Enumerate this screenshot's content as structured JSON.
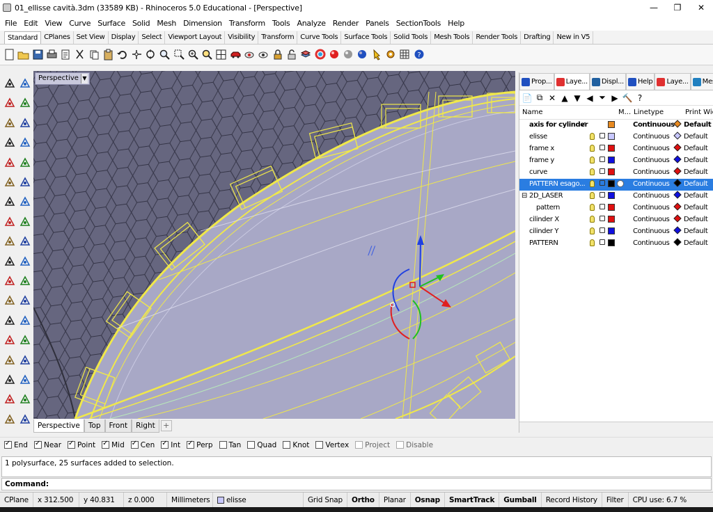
{
  "title": "01_ellisse cavità.3dm (33589 KB) - Rhinoceros 5.0 Educational - [Perspective]",
  "window_controls": {
    "minimize": "—",
    "maximize": "❐",
    "close": "✕"
  },
  "menu": [
    "File",
    "Edit",
    "View",
    "Curve",
    "Surface",
    "Solid",
    "Mesh",
    "Dimension",
    "Transform",
    "Tools",
    "Analyze",
    "Render",
    "Panels",
    "SectionTools",
    "Help"
  ],
  "toolbar_tabs": [
    "Standard",
    "CPlanes",
    "Set View",
    "Display",
    "Select",
    "Viewport Layout",
    "Visibility",
    "Transform",
    "Curve Tools",
    "Surface Tools",
    "Solid Tools",
    "Mesh Tools",
    "Render Tools",
    "Drafting",
    "New in V5"
  ],
  "toolbar_icons": [
    "new-icon",
    "open-icon",
    "save-icon",
    "print-icon",
    "import-icon",
    "cut-icon",
    "copy-icon",
    "paste-icon",
    "undo-icon",
    "pan-icon",
    "rotate-view-icon",
    "zoom-dynamic-icon",
    "zoom-window-icon",
    "zoom-extents-icon",
    "zoom-selected-icon",
    "four-view-icon",
    "car-icon",
    "hide-icon",
    "show-icon",
    "lock-icon",
    "unlock-icon",
    "layer-icon",
    "color-wheel-icon",
    "render-sphere-icon",
    "gray-sphere-icon",
    "blue-sphere-icon",
    "light-icon",
    "settings-icon",
    "grid-options-icon",
    "help-icon"
  ],
  "viewport": {
    "label": "Perspective",
    "arrow": "▼"
  },
  "viewport_tabs": [
    "Perspective",
    "Top",
    "Front",
    "Right"
  ],
  "viewport_add": "+",
  "panel_tabs": [
    "Prop...",
    "Laye...",
    "Displ...",
    "Help",
    "Laye...",
    "Mesh..."
  ],
  "layer_tools": [
    "📄",
    "⧉",
    "✕",
    "▲",
    "▼",
    "◀",
    "⏷",
    "▶",
    "🔨",
    "?"
  ],
  "layer_columns": {
    "name": "Name",
    "material": "M...",
    "linetype": "Linetype",
    "print_width": "Print Width"
  },
  "layers": [
    {
      "name": "axis for cylinder",
      "check": "✓",
      "color": "#e88a20",
      "linetype": "Continuous",
      "print_width": "Default",
      "indent": 0,
      "current": true,
      "selected": false
    },
    {
      "name": "elisse",
      "color": "#c8c8ff",
      "linetype": "Continuous",
      "print_width": "Default",
      "indent": 0,
      "current": false,
      "selected": false
    },
    {
      "name": "frame x",
      "color": "#e01010",
      "linetype": "Continuous",
      "print_width": "Default",
      "indent": 0,
      "current": false,
      "selected": false
    },
    {
      "name": "frame y",
      "color": "#1010e0",
      "linetype": "Continuous",
      "print_width": "Default",
      "indent": 0,
      "current": false,
      "selected": false
    },
    {
      "name": "curve",
      "color": "#e01010",
      "linetype": "Continuous",
      "print_width": "Default",
      "indent": 0,
      "current": false,
      "selected": false
    },
    {
      "name": "PATTERN esago...",
      "color": "#000000",
      "linetype": "Continuous",
      "print_width": "Default",
      "indent": 0,
      "current": false,
      "selected": true
    },
    {
      "name": "2D_LASER",
      "expander": "⊟",
      "color": "#1010e0",
      "linetype": "Continuous",
      "print_width": "Default",
      "indent": 0,
      "current": false,
      "selected": false
    },
    {
      "name": "pattern",
      "color": "#e01010",
      "linetype": "Continuous",
      "print_width": "Default",
      "indent": 1,
      "current": false,
      "selected": false
    },
    {
      "name": "cilinder X",
      "color": "#e01010",
      "linetype": "Continuous",
      "print_width": "Default",
      "indent": 0,
      "current": false,
      "selected": false
    },
    {
      "name": "cilinder Y",
      "color": "#1010e0",
      "linetype": "Continuous",
      "print_width": "Default",
      "indent": 0,
      "current": false,
      "selected": false
    },
    {
      "name": "PATTERN",
      "color": "#000000",
      "linetype": "Continuous",
      "print_width": "Default",
      "indent": 0,
      "current": false,
      "selected": false
    }
  ],
  "osnaps": [
    {
      "label": "End",
      "checked": true
    },
    {
      "label": "Near",
      "checked": true
    },
    {
      "label": "Point",
      "checked": true
    },
    {
      "label": "Mid",
      "checked": true
    },
    {
      "label": "Cen",
      "checked": true
    },
    {
      "label": "Int",
      "checked": true
    },
    {
      "label": "Perp",
      "checked": true
    },
    {
      "label": "Tan",
      "checked": false
    },
    {
      "label": "Quad",
      "checked": false
    },
    {
      "label": "Knot",
      "checked": false
    },
    {
      "label": "Vertex",
      "checked": false
    },
    {
      "label": "Project",
      "checked": false,
      "disabled": true
    },
    {
      "label": "Disable",
      "checked": false,
      "disabled": true
    }
  ],
  "history": "1 polysurface, 25 surfaces added to selection.",
  "command_label": "Command:",
  "status": {
    "cplane": "CPlane",
    "x": "x 312.500",
    "y": "y 40.831",
    "z": "z 0.000",
    "units": "Millimeters",
    "layer": "elisse",
    "layer_color": "#c8c8ff",
    "grid_snap": "Grid Snap",
    "ortho": "Ortho",
    "planar": "Planar",
    "osnap": "Osnap",
    "smarttrack": "SmartTrack",
    "gumball": "Gumball",
    "record_history": "Record History",
    "filter": "Filter",
    "cpu": "CPU use: 6.7 %"
  },
  "colors": {
    "accent": "#2a7de1",
    "viewport_bg": "#a8a8c8",
    "wire": "#f0e84a"
  }
}
